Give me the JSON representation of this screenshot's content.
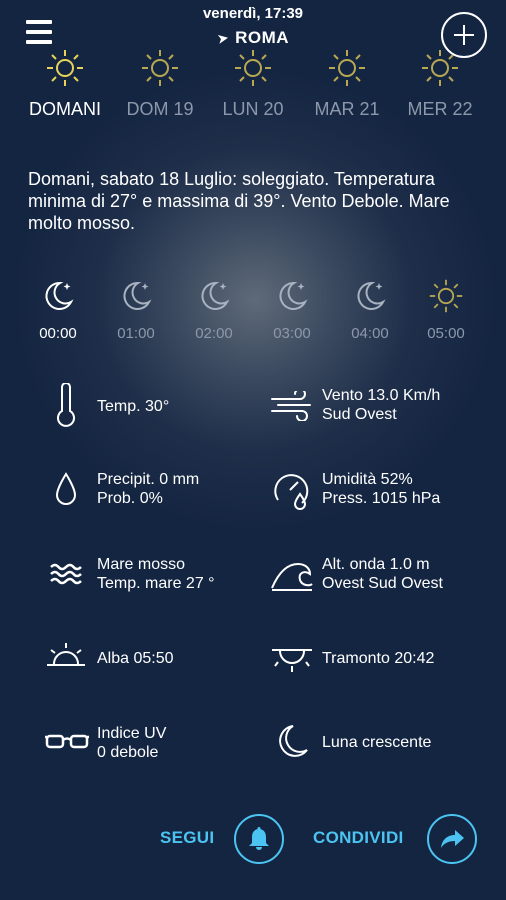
{
  "header": {
    "clock": "venerdì, 17:39",
    "city": "ROMA"
  },
  "days": [
    {
      "label": "DOMANI",
      "icon": "sun-icon",
      "selected": true
    },
    {
      "label": "DOM 19",
      "icon": "sun-icon",
      "selected": false
    },
    {
      "label": "LUN 20",
      "icon": "sun-icon",
      "selected": false
    },
    {
      "label": "MAR 21",
      "icon": "sun-icon",
      "selected": false
    },
    {
      "label": "MER 22",
      "icon": "sun-icon",
      "selected": false
    }
  ],
  "summary": "Domani, sabato 18 Luglio: soleggiato. Temperatura minima di 27° e massima di 39°. Vento Debole. Mare molto mosso.",
  "hours": [
    {
      "time": "00:00",
      "icon": "moon-icon",
      "selected": true
    },
    {
      "time": "01:00",
      "icon": "moon-icon",
      "selected": false
    },
    {
      "time": "02:00",
      "icon": "moon-icon",
      "selected": false
    },
    {
      "time": "03:00",
      "icon": "moon-icon",
      "selected": false
    },
    {
      "time": "04:00",
      "icon": "moon-icon",
      "selected": false
    },
    {
      "time": "05:00",
      "icon": "sun-icon",
      "selected": false
    }
  ],
  "details": {
    "temp": "Temp. 30°",
    "wind_line1": "Vento 13.0 Km/h",
    "wind_line2": "Sud Ovest",
    "precip_line1": "Precipit. 0 mm",
    "precip_line2": "Prob. 0%",
    "humidity_line1": "Umidità 52%",
    "humidity_line2": "Press. 1015 hPa",
    "sea_line1": "Mare mosso",
    "sea_line2": "Temp. mare 27 °",
    "wave_line1": "Alt. onda 1.0 m",
    "wave_line2": "Ovest Sud Ovest",
    "sunrise": "Alba 05:50",
    "sunset": "Tramonto 20:42",
    "uv_line1": "Indice UV",
    "uv_line2": "0 debole",
    "moon": "Luna crescente"
  },
  "actions": {
    "follow_label": "SEGUI",
    "share_label": "CONDIVIDI"
  },
  "colors": {
    "accent": "#4cc4f2",
    "sun": "#e8d25a",
    "sun_dim": "#b9a852",
    "dim_text": "#8d98aa"
  }
}
